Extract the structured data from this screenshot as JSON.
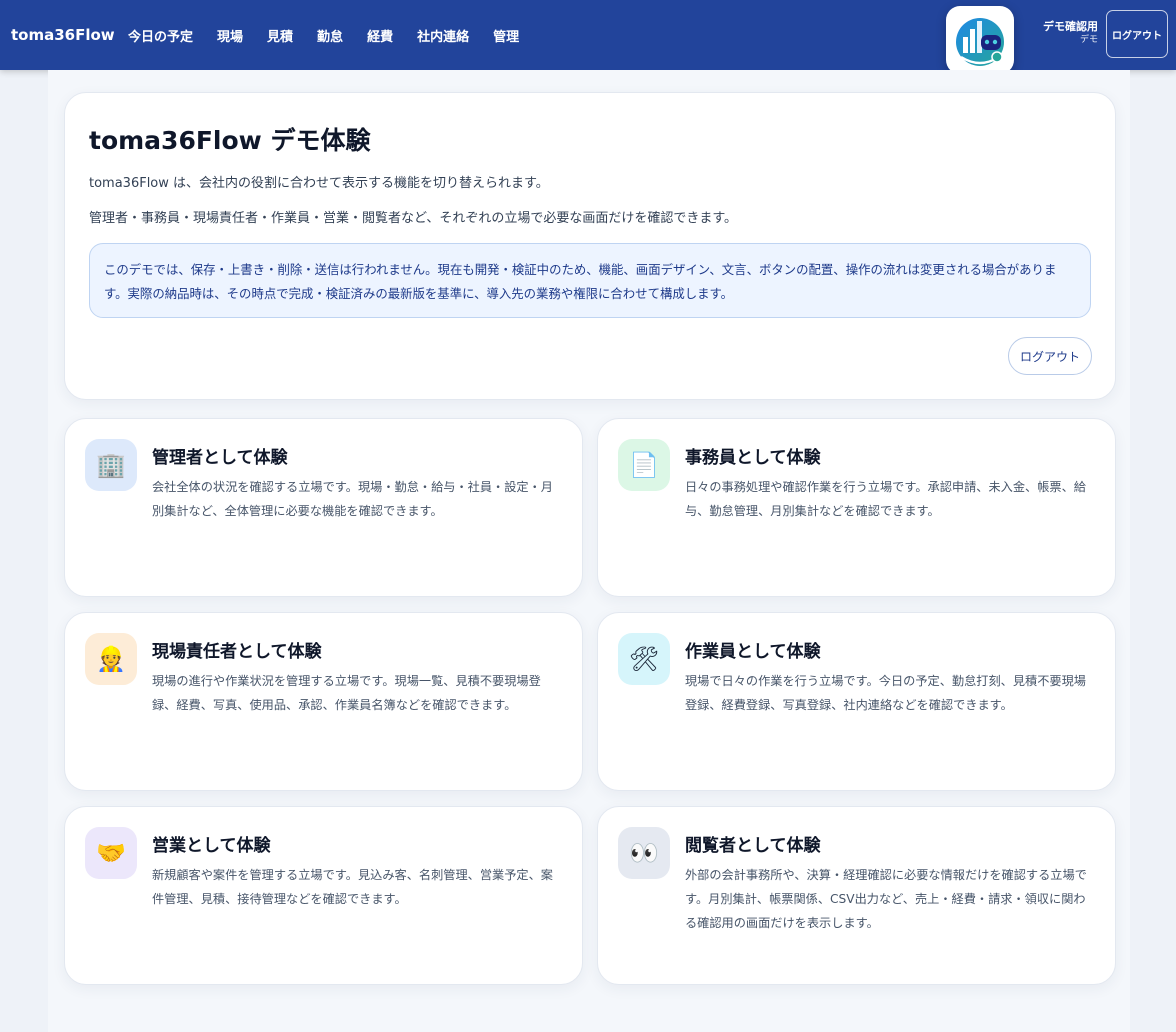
{
  "header": {
    "brand": "toma36Flow",
    "nav": [
      "今日の予定",
      "現場",
      "見積",
      "勤怠",
      "経費",
      "社内連絡",
      "管理"
    ],
    "user_name": "デモ確認用",
    "user_role": "デモ",
    "logout_label": "ログアウト",
    "logo_icon": "robot-chart-logo-icon"
  },
  "intro": {
    "title": "toma36Flow デモ体験",
    "p1": "toma36Flow は、会社内の役割に合わせて表示する機能を切り替えられます。",
    "p2": "管理者・事務員・現場責任者・作業員・営業・閲覧者など、それぞれの立場で必要な画面だけを確認できます。",
    "notice": "このデモでは、保存・上書き・削除・送信は行われません。現在も開発・検証中のため、機能、画面デザイン、文言、ボタンの配置、操作の流れは変更される場合があります。実際の納品時は、その時点で完成・検証済みの最新版を基準に、導入先の業務や権限に合わせて構成します。",
    "logout_label": "ログアウト"
  },
  "roles": [
    {
      "title": "管理者として体験",
      "desc": "会社全体の状況を確認する立場です。現場・勤怠・給与・社員・設定・月別集計など、全体管理に必要な機能を確認できます。",
      "icon": "office-building-icon",
      "glyph": "🏢",
      "bg": "#dde9fb"
    },
    {
      "title": "事務員として体験",
      "desc": "日々の事務処理や確認作業を行う立場です。承認申請、未入金、帳票、給与、勤怠管理、月別集計などを確認できます。",
      "icon": "document-icon",
      "glyph": "📄",
      "bg": "#dcf7e6"
    },
    {
      "title": "現場責任者として体験",
      "desc": "現場の進行や作業状況を管理する立場です。現場一覧、見積不要現場登録、経費、写真、使用品、承認、作業員名簿などを確認できます。",
      "icon": "construction-worker-icon",
      "glyph": "👷",
      "bg": "#fdecd7"
    },
    {
      "title": "作業員として体験",
      "desc": "現場で日々の作業を行う立場です。今日の予定、勤怠打刻、見積不要現場登録、経費登録、写真登録、社内連絡などを確認できます。",
      "icon": "tools-icon",
      "glyph": "🛠",
      "bg": "#d6f5fb"
    },
    {
      "title": "営業として体験",
      "desc": "新規顧客や案件を管理する立場です。見込み客、名刺管理、営業予定、案件管理、見積、接待管理などを確認できます。",
      "icon": "handshake-icon",
      "glyph": "🤝",
      "bg": "#ece7fb"
    },
    {
      "title": "閲覧者として体験",
      "desc": "外部の会計事務所や、決算・経理確認に必要な情報だけを確認する立場です。月別集計、帳票関係、CSV出力など、売上・経費・請求・領収に関わる確認用の画面だけを表示します。",
      "icon": "eyes-icon",
      "glyph": "👀",
      "bg": "#e5e9f1"
    }
  ]
}
